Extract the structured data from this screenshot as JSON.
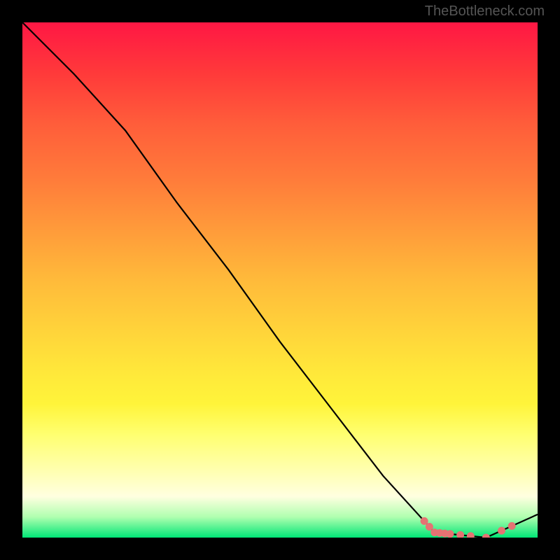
{
  "attribution": "TheBottleneck.com",
  "chart_data": {
    "type": "line",
    "title": "",
    "xlabel": "",
    "ylabel": "",
    "x": [
      0,
      1,
      2,
      3,
      4,
      5,
      6,
      7,
      8,
      9,
      10
    ],
    "values": [
      100,
      90,
      79,
      65,
      52,
      38,
      25,
      12,
      1,
      0,
      4.5
    ],
    "ylim": [
      0,
      100
    ],
    "markers_at_x": [
      7.8,
      7.9,
      8.0,
      8.1,
      8.2,
      8.3,
      8.5,
      8.7,
      9.0,
      9.3,
      9.5
    ],
    "notes": "Bottleneck curve over a thermal gradient. Y represents bottleneck percentage (100 = fully bottlenecked, 0 = balanced). The curve descends from top-left, reaches minimum near x≈8–9.5 (red markers cluster), then rises slightly at the right edge."
  }
}
